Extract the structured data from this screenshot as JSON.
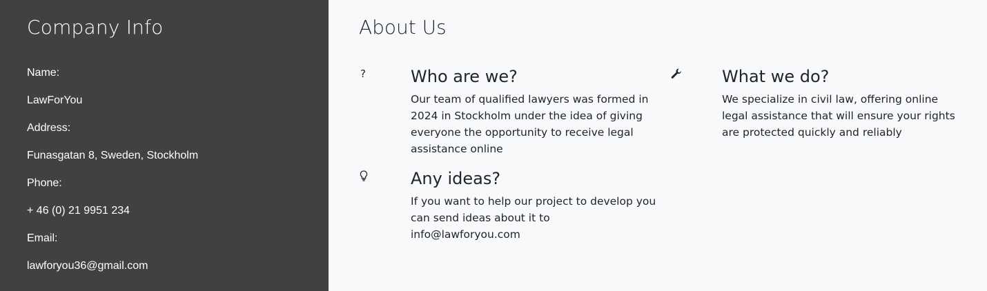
{
  "company": {
    "title": "Company Info",
    "lines": [
      "Name:",
      "LawForYou",
      "Address:",
      "Funasgatan 8, Sweden, Stockholm",
      "Phone:",
      "+ 46 (0) 21 9951 234",
      "Email:",
      "lawforyou36@gmail.com"
    ]
  },
  "about": {
    "title": "About Us",
    "features": [
      {
        "icon": "question-icon",
        "title": "Who are we?",
        "text": "Our team of qualified lawyers was formed in 2024 in Stockholm under the idea of giving everyone the opportunity to receive legal assistance online"
      },
      {
        "icon": "wrench-icon",
        "title": "What we do?",
        "text": "We specialize in civil law, offering online legal assistance that will ensure your rights are protected quickly and reliably"
      },
      {
        "icon": "lightbulb-icon",
        "title": "Any ideas?",
        "text": "If you want to help our project to develop you can send ideas about it to info@lawforyou.com"
      }
    ]
  },
  "colors": {
    "sidebar_bg": "#414141",
    "page_bg": "#f8f9fb",
    "text": "#212529"
  }
}
